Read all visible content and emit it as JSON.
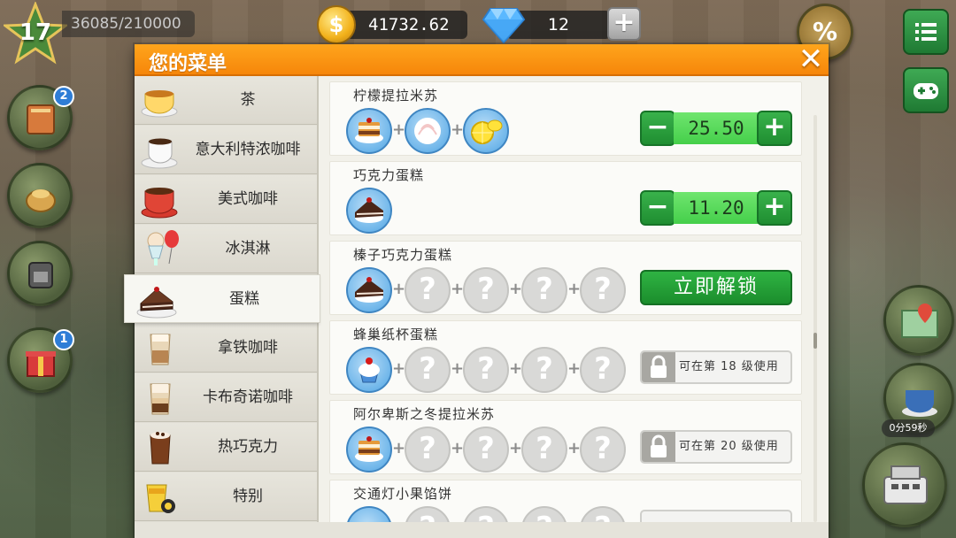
{
  "hud": {
    "level": "17",
    "xp": "36085/210000",
    "coins": "41732.62",
    "gems": "12",
    "gem_add": "+",
    "coin_symbol": "$"
  },
  "side_buttons": {
    "recipe_book_badge": "2",
    "gift_badge": "1",
    "timer": "0分59秒"
  },
  "dialog": {
    "title": "您的菜单",
    "close": "✕",
    "categories": [
      {
        "label": "茶",
        "icon": "tea-cup-icon"
      },
      {
        "label": "意大利特浓咖啡",
        "icon": "espresso-cup-icon"
      },
      {
        "label": "美式咖啡",
        "icon": "americano-cup-icon"
      },
      {
        "label": "冰淇淋",
        "icon": "ice-cream-icon"
      },
      {
        "label": "蛋糕",
        "icon": "cake-icon"
      },
      {
        "label": "拿铁咖啡",
        "icon": "latte-glass-icon"
      },
      {
        "label": "卡布奇诺咖啡",
        "icon": "cappuccino-glass-icon"
      },
      {
        "label": "热巧克力",
        "icon": "hot-chocolate-icon"
      },
      {
        "label": "特别",
        "icon": "special-drink-icon"
      }
    ],
    "active_category": "蛋糕",
    "recipes": [
      {
        "name": "柠檬提拉米苏",
        "ingredients": [
          "tiramisu-icon",
          "whipped-cream-icon",
          "lemon-icon"
        ],
        "price": "25.50",
        "minus": "−",
        "plus": "+"
      },
      {
        "name": "巧克力蛋糕",
        "ingredients": [
          "chocolate-cake-icon"
        ],
        "price": "11.20",
        "minus": "−",
        "plus": "+"
      },
      {
        "name": "榛子巧克力蛋糕",
        "ingredients": [
          "chocolate-cake-icon",
          "?",
          "?",
          "?",
          "?"
        ],
        "unlock_label": "立即解锁"
      },
      {
        "name": "蜂巢纸杯蛋糕",
        "ingredients": [
          "cupcake-icon",
          "?",
          "?",
          "?",
          "?"
        ],
        "lock_text": "可在第 18 级使用"
      },
      {
        "name": "阿尔卑斯之冬提拉米苏",
        "ingredients": [
          "tiramisu-icon",
          "?",
          "?",
          "?",
          "?"
        ],
        "lock_text": "可在第 20 级使用"
      },
      {
        "name": "交通灯小果馅饼",
        "ingredients": [
          "tart-icon",
          "?",
          "?",
          "?",
          "?"
        ]
      }
    ],
    "unknown_symbol": "?",
    "plus_symbol": "+"
  },
  "colors": {
    "header_orange": "#f6860a",
    "button_green": "#1f8e31",
    "price_green": "#45cf4a",
    "ingredient_blue": "#6fb6ea"
  }
}
